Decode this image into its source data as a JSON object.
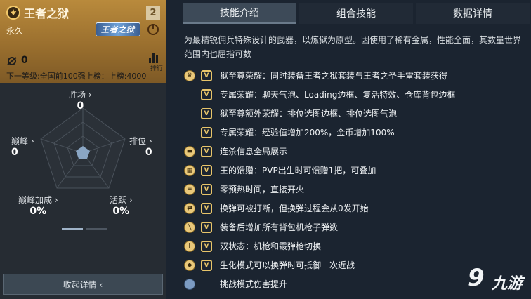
{
  "card": {
    "weapon_name": "王者之狱",
    "slot_number": "2",
    "duration": "永久",
    "logo_text": "王者之狱",
    "kill_count": "0",
    "rank_label": "排行",
    "next_level": "下一等级:全国前100强上榜：上榜:4000",
    "accent_color": "#b98a3c"
  },
  "stats": {
    "win_rate": {
      "label": "胜场 ›",
      "value": "0"
    },
    "peak": {
      "label": "巅峰 ›",
      "value": "0"
    },
    "rank": {
      "label": "排位 ›",
      "value": "0"
    },
    "peak_bonus": {
      "label": "巅峰加成 ›",
      "value": "0%"
    },
    "activity": {
      "label": "活跃 ›",
      "value": "0%"
    }
  },
  "collapse_label": "收起详情  ‹",
  "tabs": [
    {
      "label": "技能介绍",
      "active": true
    },
    {
      "label": "组合技能",
      "active": false
    },
    {
      "label": "数据详情",
      "active": false
    }
  ],
  "description": "为最精锐佣兵特殊设计的武器，以炼狱为原型。因使用了稀有金属，性能全面，其数量世界范围内也屈指可数",
  "features": [
    {
      "cat_icon": "crown-icon",
      "v_icon": true,
      "text": "狱至尊荣耀：同时装备王者之狱套装与王者之圣手雷套装获得"
    },
    {
      "cat_icon": "",
      "v_icon": true,
      "text": "专属荣耀：聊天气泡、Loading边框、复活特效、仓库背包边框"
    },
    {
      "cat_icon": "",
      "v_icon": true,
      "text": "狱至尊额外荣耀：排位选图边框、排位选图气泡"
    },
    {
      "cat_icon": "",
      "v_icon": true,
      "text": "专属荣耀：经验值增加200%，金币增加100%"
    },
    {
      "cat_icon": "killstreak-icon",
      "v_icon": true,
      "text": "连杀信息全局展示"
    },
    {
      "cat_icon": "gift-icon",
      "v_icon": true,
      "text": "王的馈赠：PVP出生时可馈赠1把，可叠加"
    },
    {
      "cat_icon": "preheat-icon",
      "v_icon": true,
      "text": "零预热时间，直接开火"
    },
    {
      "cat_icon": "reload-icon",
      "v_icon": true,
      "text": "换弹可被打断，但换弹过程会从0发开始"
    },
    {
      "cat_icon": "ammo-icon",
      "v_icon": true,
      "text": "装备后增加所有背包机枪子弹数"
    },
    {
      "cat_icon": "dual-mode-icon",
      "v_icon": true,
      "text": "双状态：机枪和霰弹枪切换"
    },
    {
      "cat_icon": "shield-icon",
      "v_icon": true,
      "text": "生化模式可以换弹时可抵御一次近战"
    },
    {
      "cat_icon": "challenge-icon",
      "v_icon": false,
      "text": "挑战模式伤害提升"
    }
  ],
  "watermark": {
    "logo": "9",
    "text": "九游"
  }
}
